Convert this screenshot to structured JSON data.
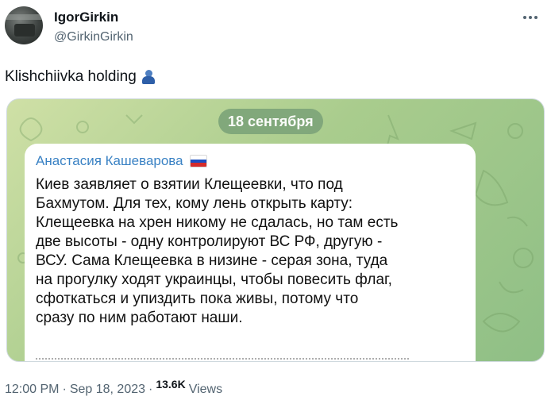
{
  "author": {
    "display_name": "IgorGirkin",
    "handle": "@GirkinGirkin"
  },
  "tweet": {
    "text": "Klishchiivka holding",
    "emoji": "people-hugging-emoji"
  },
  "media": {
    "date_label": "18 сентября",
    "message_author": "Анастасия Кашеварова",
    "message_lines": [
      "Киев заявляет о взятии Клещеевки, что под",
      "Бахмутом. Для тех, кому лень открыть карту:",
      "Клещеевка на хрен никому не сдалась, но там есть",
      "две высоты - одну контролируют ВС РФ, другую -",
      "ВСУ. Сама Клещеевка в низине - серая зона, туда",
      "на прогулку ходят украинцы, чтобы повесить флаг,",
      "сфоткаться и упиздить пока живы, потому что",
      "сразу по ним работают наши."
    ],
    "colors": {
      "chat_background": "#a9cc8d",
      "author_name": "#3a82c4",
      "bubble": "#ffffff"
    }
  },
  "footer": {
    "time": "12:00 PM",
    "separator": "·",
    "date": "Sep 18, 2023",
    "separator2": "·",
    "views_count": "13.6K",
    "views_label": "Views"
  }
}
